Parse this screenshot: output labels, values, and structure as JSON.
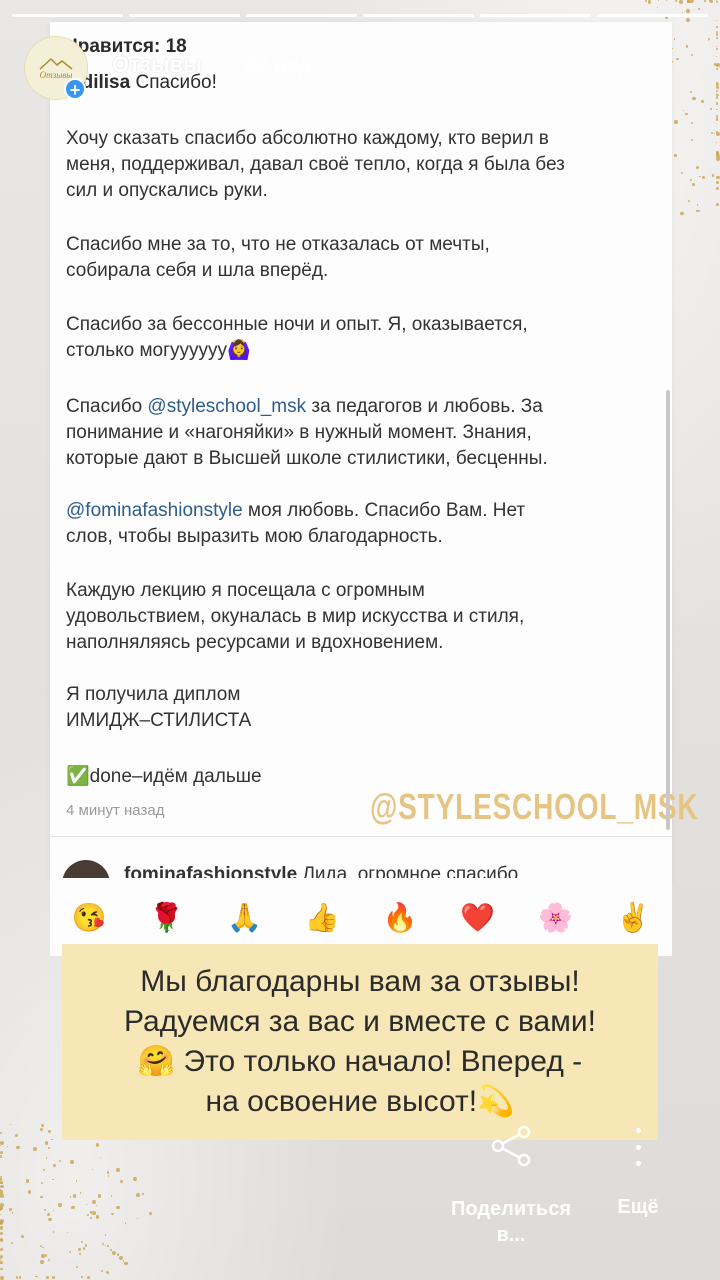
{
  "story": {
    "title": "Отзывы",
    "time": "22 нед.",
    "avatar_label": "Отзывы",
    "segments": 6
  },
  "post": {
    "likes": "Нравится: 18",
    "author": "Vidilisa",
    "author_msg": "Спасибо!",
    "paragraphs": [
      [
        "Хочу сказать спасибо абсолютно каждому, кто верил в",
        "меня, поддерживал, давал своё тепло, когда я была без",
        "сил и опускались руки."
      ],
      [
        "Спасибо мне за то, что не отказалась от мечты,",
        "собирала себя и шла вперёд."
      ],
      [
        "Спасибо за бессонные ночи и опыт. Я, оказывается,",
        "столько могуууууу🙆‍♀️"
      ]
    ],
    "p4_prefix": "Спасибо ",
    "p4_mention": "@styleschool_msk",
    "p4_rest1": " за педагогов и любовь. За",
    "p4_line2": "понимание и «нагоняйки» в нужный момент. Знания,",
    "p4_line3": "которые дают в Высшей школе стилистики, бесценны.",
    "p5_mention": "@fominafashionstyle",
    "p5_rest1": " моя любовь. Спасибо Вам. Нет",
    "p5_line2": "слов, чтобы выразить мою благодарность.",
    "p6_lines": [
      "Каждую лекцию я посещала с огромным",
      "удовольствием, окуналась в мир искусства и стиля,",
      "наполняляясь ресурсами и вдохновением."
    ],
    "p7_lines": [
      "Я получила диплом",
      "ИМИДЖ–СТИЛИСТА"
    ],
    "p8": "✅done–идём дальше",
    "time_ago": "4 минут назад",
    "watermark": "@STYLESCHOOL_MSK",
    "reply_author": "fominafashionstyle",
    "reply_text": "Лида, огромное спасибо"
  },
  "emoji_row": [
    "😘",
    "🌹",
    "🙏",
    "👍",
    "🔥",
    "❤️",
    "🌸",
    "✌️"
  ],
  "banner": {
    "lines": [
      "Мы благодарны вам за отзывы!",
      "Радуемся за вас и вместе с вами!",
      "🤗 Это только начало! Вперед -",
      "на освоение высот!💫"
    ]
  },
  "actions": {
    "share_label": "Поделиться в...",
    "more_label": "Ещё"
  }
}
